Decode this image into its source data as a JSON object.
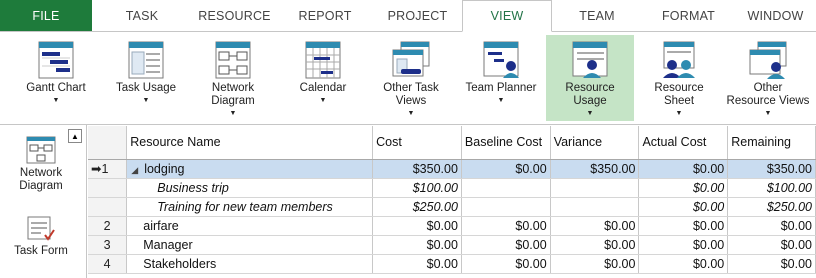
{
  "tabs": [
    "FILE",
    "TASK",
    "RESOURCE",
    "REPORT",
    "PROJECT",
    "VIEW",
    "TEAM",
    "FORMAT",
    "WINDOW"
  ],
  "active_tab": "VIEW",
  "ribbon": {
    "gantt_chart": "Gantt Chart",
    "task_usage": "Task Usage",
    "network_diagram_1": "Network",
    "network_diagram_2": "Diagram",
    "calendar": "Calendar",
    "other_task_views_1": "Other Task",
    "other_task_views_2": "Views",
    "team_planner": "Team Planner",
    "resource_usage_1": "Resource",
    "resource_usage_2": "Usage",
    "resource_sheet": "Resource Sheet",
    "other_resource_views_1": "Other",
    "other_resource_views_2": "Resource Views"
  },
  "viewbar": {
    "network_diagram_1": "Network",
    "network_diagram_2": "Diagram",
    "task_form": "Task Form"
  },
  "grid": {
    "headers": [
      "Resource Name",
      "Cost",
      "Baseline Cost",
      "Variance",
      "Actual Cost",
      "Remaining"
    ],
    "rows": [
      {
        "id": "1",
        "marker": "➡",
        "collapse": "◢",
        "name": "lodging",
        "cost": "$350.00",
        "baseline": "$0.00",
        "variance": "$350.00",
        "actual": "$0.00",
        "remaining": "$350.00"
      },
      {
        "id": "",
        "name": "Business trip",
        "cost": "$100.00",
        "baseline": "",
        "variance": "",
        "actual": "$0.00",
        "remaining": "$100.00"
      },
      {
        "id": "",
        "name": "Training for new team members",
        "cost": "$250.00",
        "baseline": "",
        "variance": "",
        "actual": "$0.00",
        "remaining": "$250.00"
      },
      {
        "id": "2",
        "name": "airfare",
        "cost": "$0.00",
        "baseline": "$0.00",
        "variance": "$0.00",
        "actual": "$0.00",
        "remaining": "$0.00"
      },
      {
        "id": "3",
        "name": "Manager",
        "cost": "$0.00",
        "baseline": "$0.00",
        "variance": "$0.00",
        "actual": "$0.00",
        "remaining": "$0.00"
      },
      {
        "id": "4",
        "name": "Stakeholders",
        "cost": "$0.00",
        "baseline": "$0.00",
        "variance": "$0.00",
        "actual": "$0.00",
        "remaining": "$0.00"
      }
    ]
  },
  "colors": {
    "file_tab": "#1e7b3b",
    "selected_button": "#c5e4c6",
    "highlight_row": "#c9dcf0",
    "icon_teal": "#2e8bb0",
    "icon_navy": "#1d2f8a"
  }
}
